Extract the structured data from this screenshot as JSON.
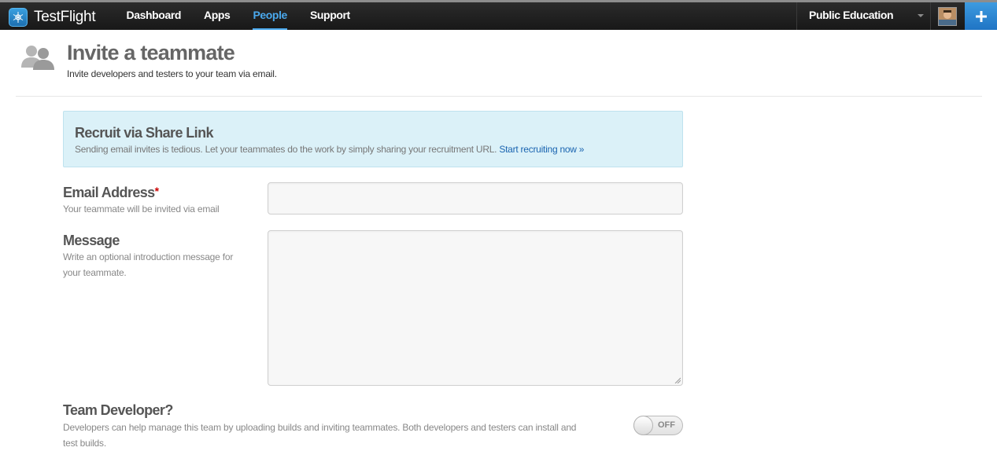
{
  "app": {
    "name": "TestFlight"
  },
  "nav": {
    "items": [
      {
        "label": "Dashboard",
        "active": false
      },
      {
        "label": "Apps",
        "active": false
      },
      {
        "label": "People",
        "active": true
      },
      {
        "label": "Support",
        "active": false
      }
    ],
    "team": "Public Education"
  },
  "header": {
    "title": "Invite a teammate",
    "subtitle": "Invite developers and testers to your team via email."
  },
  "share": {
    "title": "Recruit via Share Link",
    "description": "Sending email invites is tedious. Let your teammates do the work by simply sharing your recruitment URL.",
    "link_label": "Start recruiting now »"
  },
  "form": {
    "email": {
      "label": "Email Address",
      "required_mark": "*",
      "hint": "Your teammate will be invited via email",
      "value": ""
    },
    "message": {
      "label": "Message",
      "hint": "Write an optional introduction message for your teammate.",
      "value": ""
    },
    "developer": {
      "label": "Team Developer?",
      "hint": "Developers can help manage this team by uploading builds and inviting teammates. Both developers and testers can install and test builds.",
      "toggle": "OFF"
    }
  },
  "colors": {
    "accent": "#4aa8ec",
    "share_bg": "#dbf1f8",
    "link": "#1a64b0",
    "required": "#cc0000"
  }
}
